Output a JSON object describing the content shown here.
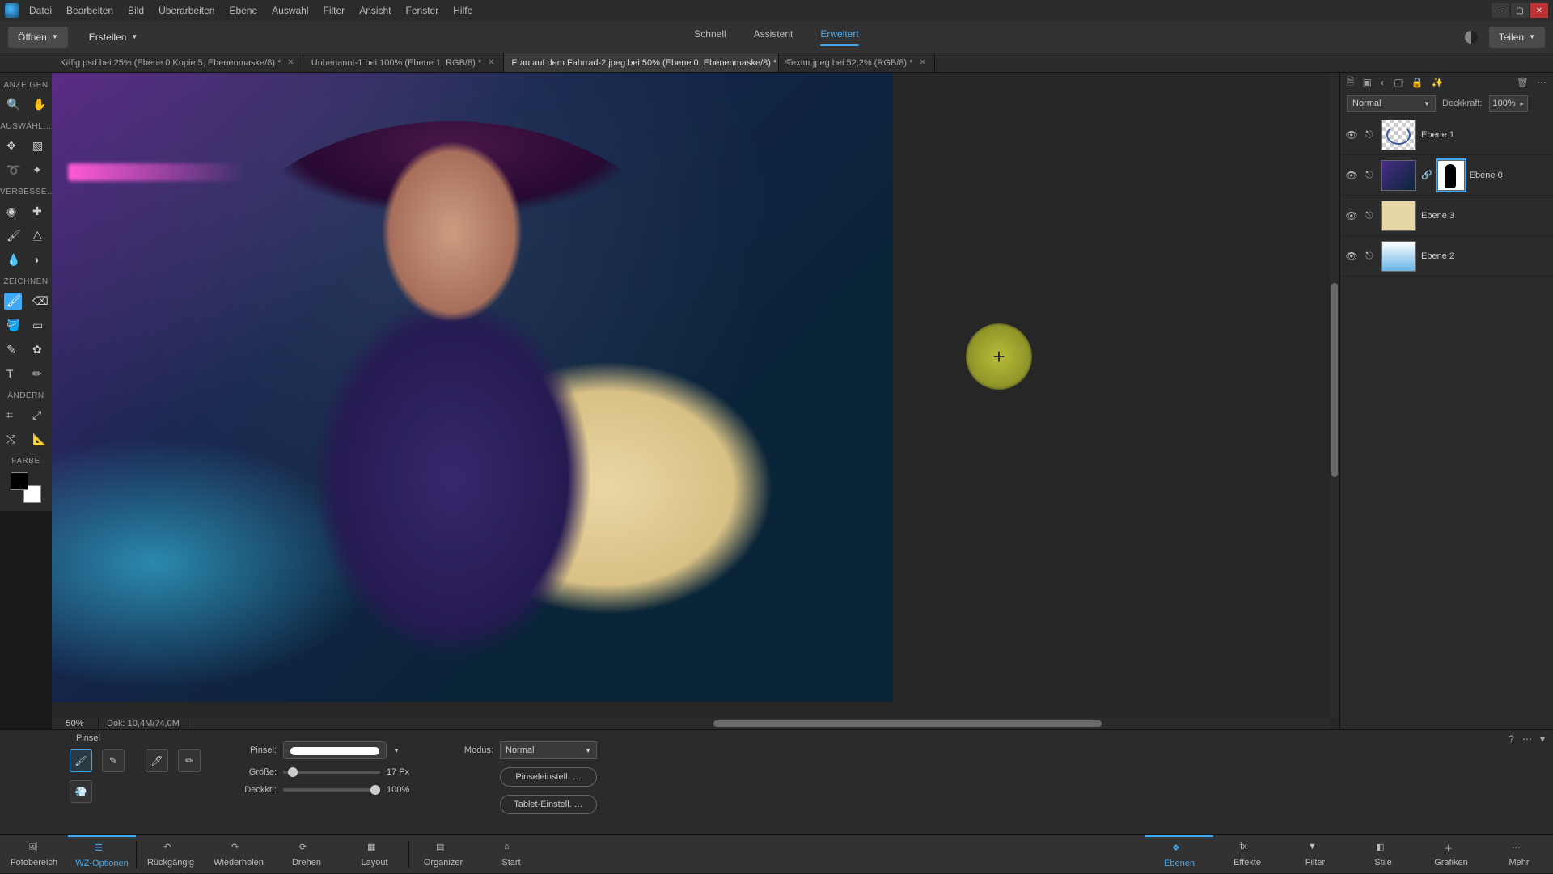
{
  "menu": {
    "items": [
      "Datei",
      "Bearbeiten",
      "Bild",
      "Überarbeiten",
      "Ebene",
      "Auswahl",
      "Filter",
      "Ansicht",
      "Fenster",
      "Hilfe"
    ]
  },
  "actionbar": {
    "open": "Öffnen",
    "create": "Erstellen",
    "modes": {
      "quick": "Schnell",
      "assistant": "Assistent",
      "advanced": "Erweitert",
      "active": "Erweitert"
    },
    "share": "Teilen"
  },
  "doctabs": [
    {
      "label": "Käfig.psd bei 25% (Ebene 0 Kopie 5, Ebenenmaske/8) *"
    },
    {
      "label": "Unbenannt-1 bei 100% (Ebene 1, RGB/8) *"
    },
    {
      "label": "Frau auf dem Fahrrad-2.jpeg bei 50% (Ebene 0, Ebenenmaske/8) *",
      "active": true
    },
    {
      "label": "Textur.jpeg bei 52,2% (RGB/8) *"
    }
  ],
  "tool_sections": {
    "view": "ANZEIGEN",
    "select": "AUSWÄHL…",
    "enhance": "VERBESSE…",
    "draw": "ZEICHNEN",
    "modify": "ÄNDERN",
    "color": "FARBE"
  },
  "canvas": {
    "zoom": "50%",
    "doc_info": "Dok: 10,4M/74,0M"
  },
  "layers_panel": {
    "blend": "Normal",
    "opacity_label": "Deckkraft:",
    "opacity_value": "100%",
    "layers": [
      {
        "name": "Ebene 1"
      },
      {
        "name": "Ebene 0",
        "selected": true,
        "underline": true
      },
      {
        "name": "Ebene 3"
      },
      {
        "name": "Ebene 2"
      }
    ]
  },
  "tool_options": {
    "title": "Pinsel",
    "brush_label": "Pinsel:",
    "size_label": "Größe:",
    "size_value": "17 Px",
    "opacity_label": "Deckkr.:",
    "opacity_value": "100%",
    "mode_label": "Modus:",
    "mode_value": "Normal",
    "brush_settings": "Pinseleinstell. …",
    "tablet_settings": "Tablet-Einstell. …"
  },
  "taskbar": {
    "left": [
      "Fotobereich",
      "WZ-Optionen",
      "Rückgängig",
      "Wiederholen",
      "Drehen",
      "Layout"
    ],
    "left2": [
      "Organizer",
      "Start"
    ],
    "right": [
      "Ebenen",
      "Effekte",
      "Filter",
      "Stile",
      "Grafiken",
      "Mehr"
    ],
    "active_left": "WZ-Optionen",
    "active_right": "Ebenen"
  }
}
